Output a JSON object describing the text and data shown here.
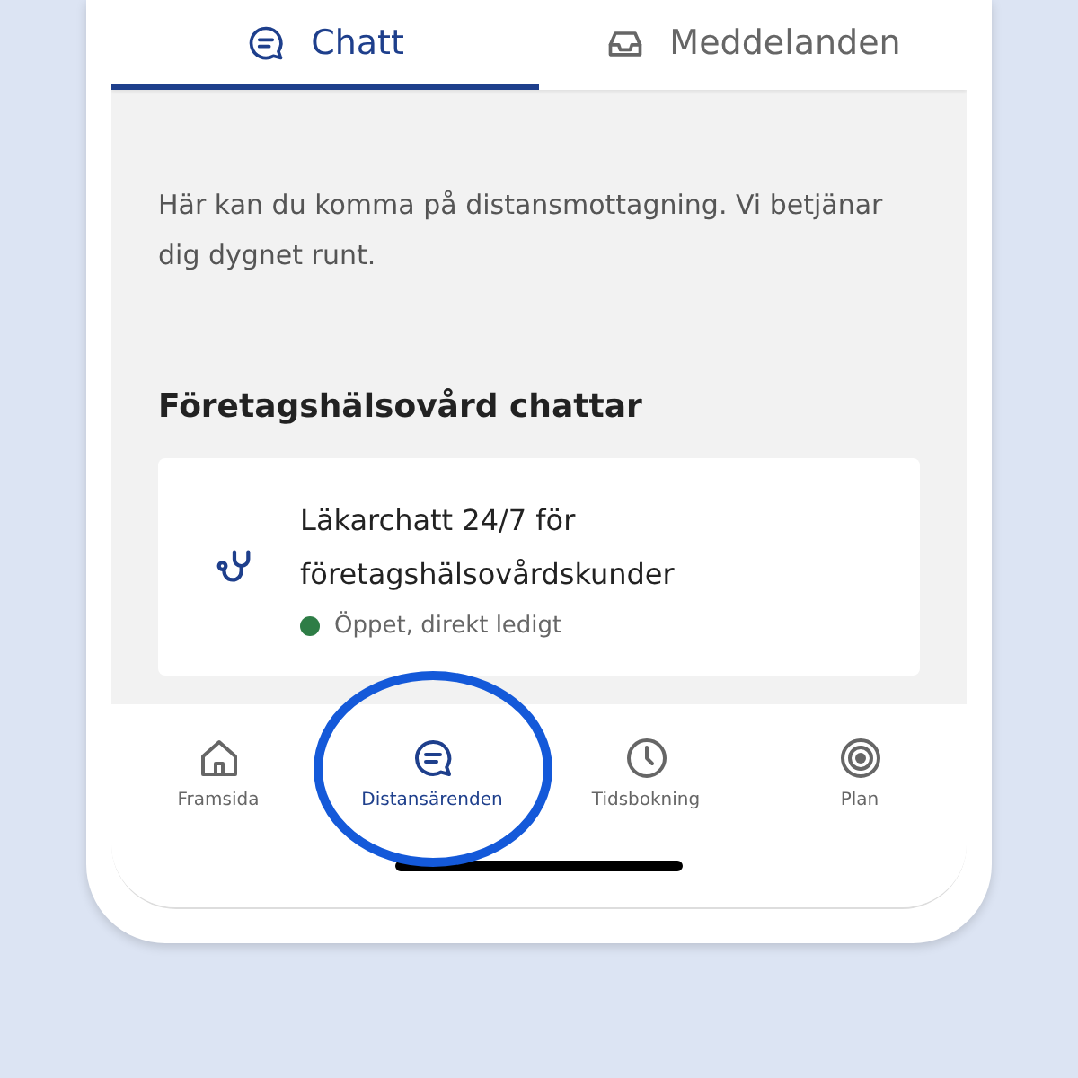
{
  "tabs": [
    {
      "label": "Chatt",
      "kind": "chat",
      "selected": true
    },
    {
      "label": "Meddelanden",
      "kind": "inbox",
      "selected": false
    }
  ],
  "intro": "Här kan du komma på distansmottagning. Vi betjänar dig dygnet runt.",
  "section": {
    "title": "Företagshälsovård chattar",
    "cards": [
      {
        "title": "Läkarchatt 24/7 för företagshälsovårdskunder",
        "status": "Öppet, direkt ledigt",
        "color": "#2e7d46"
      }
    ]
  },
  "bottom_nav": [
    {
      "label": "Framsida",
      "kind": "home",
      "selected": false,
      "circled": false
    },
    {
      "label": "Distansärenden",
      "kind": "chat",
      "selected": true,
      "circled": true
    },
    {
      "label": "Tidsbokning",
      "kind": "clock",
      "selected": false,
      "circled": false
    },
    {
      "label": "Plan",
      "kind": "target",
      "selected": false,
      "circled": false
    }
  ]
}
